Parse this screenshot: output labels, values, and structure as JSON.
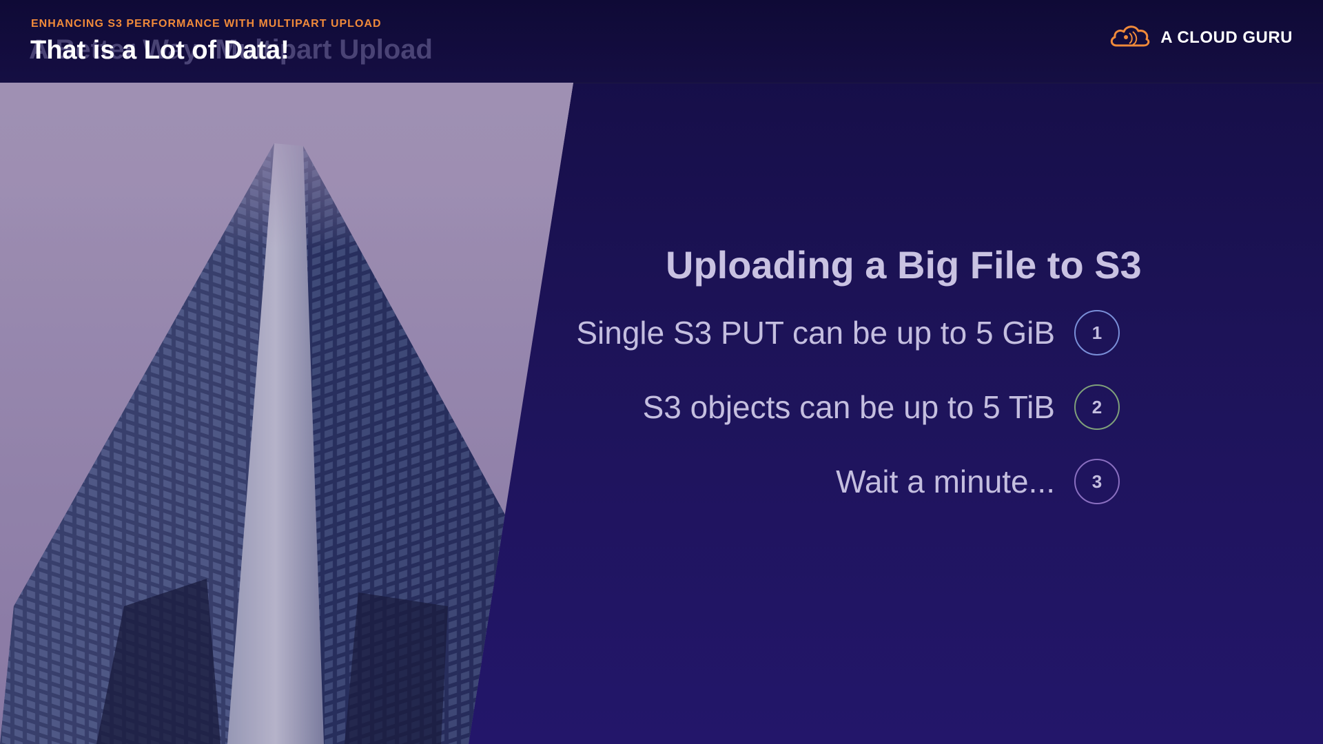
{
  "header": {
    "eyebrow": "ENHANCING S3 PERFORMANCE WITH MULTIPART UPLOAD",
    "title_ghost": "A Better Way: Multipart Upload",
    "title": "That is a Lot of Data!",
    "eyebrow_color": "#f08a3a",
    "title_color": "#ffffff"
  },
  "brand": {
    "name": "A CLOUD GURU",
    "icon": "cloud-icon",
    "icon_color": "#f08a3a",
    "text_color": "#ffffff"
  },
  "photo": {
    "icon": "skyscraper-photo"
  },
  "content": {
    "heading": "Uploading a Big File to S3",
    "heading_color": "#c9c2e2",
    "text_color": "#c4bedf",
    "points": [
      {
        "text": "Single S3 PUT can be up to 5 GiB",
        "number": "1",
        "badge_color": "#7a8fd8"
      },
      {
        "text": "S3 objects can be up to 5 TiB",
        "number": "2",
        "badge_color": "#7fa07a"
      },
      {
        "text": "Wait a minute...",
        "number": "3",
        "badge_color": "#8a6fc0"
      }
    ]
  }
}
